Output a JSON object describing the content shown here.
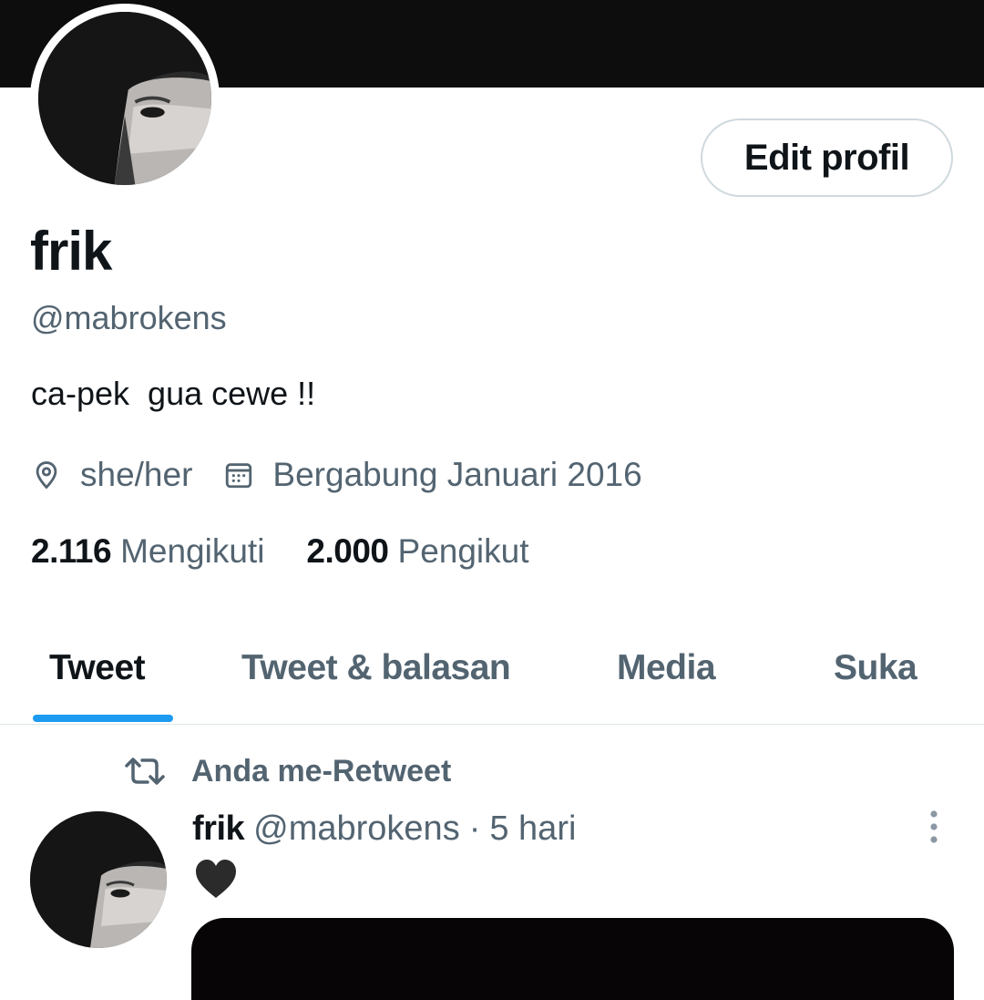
{
  "profile": {
    "display_name": "frik",
    "handle": "@mabrokens",
    "bio": "ca-pek  gua cewe !!",
    "location": "she/her",
    "joined": "Bergabung Januari 2016",
    "edit_button_label": "Edit profil",
    "avatar_icon": "profile-photo"
  },
  "stats": {
    "following_count": "2.116",
    "following_label": "Mengikuti",
    "followers_count": "2.000",
    "followers_label": "Pengikut"
  },
  "tabs": [
    {
      "label": "Tweet",
      "active": true
    },
    {
      "label": "Tweet & balasan",
      "active": false
    },
    {
      "label": "Media",
      "active": false
    },
    {
      "label": "Suka",
      "active": false
    }
  ],
  "timeline": [
    {
      "context": "Anda me-Retweet",
      "context_icon": "retweet-icon",
      "author_name": "frik",
      "author_handle": "@mabrokens",
      "separator": "·",
      "time": "5 hari",
      "content_icon": "black-heart-emoji",
      "has_media": true
    }
  ],
  "colors": {
    "accent": "#1d9bf0",
    "text_primary": "#0f1419",
    "text_secondary": "#536471",
    "banner": "#0d0d0d",
    "border": "#cfd9de"
  }
}
